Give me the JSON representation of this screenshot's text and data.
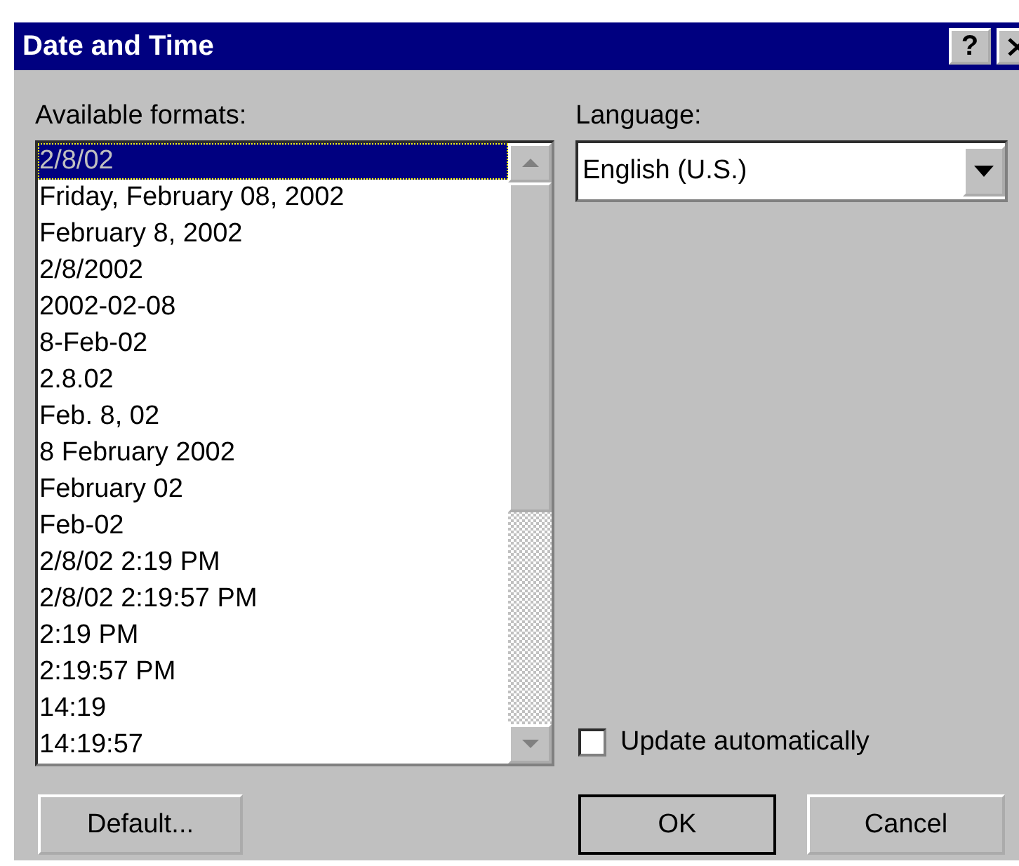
{
  "window": {
    "title": "Date and Time",
    "help_button": "?"
  },
  "formats": {
    "label": "Available formats:",
    "items": [
      {
        "text": "2/8/02",
        "selected": true
      },
      {
        "text": "Friday, February 08, 2002",
        "selected": false
      },
      {
        "text": "February 8, 2002",
        "selected": false
      },
      {
        "text": "2/8/2002",
        "selected": false
      },
      {
        "text": "2002-02-08",
        "selected": false
      },
      {
        "text": "8-Feb-02",
        "selected": false
      },
      {
        "text": "2.8.02",
        "selected": false
      },
      {
        "text": "Feb. 8, 02",
        "selected": false
      },
      {
        "text": "8 February 2002",
        "selected": false
      },
      {
        "text": "February 02",
        "selected": false
      },
      {
        "text": "Feb-02",
        "selected": false
      },
      {
        "text": "2/8/02 2:19 PM",
        "selected": false
      },
      {
        "text": "2/8/02 2:19:57 PM",
        "selected": false
      },
      {
        "text": "2:19 PM",
        "selected": false
      },
      {
        "text": "2:19:57 PM",
        "selected": false
      },
      {
        "text": "14:19",
        "selected": false
      },
      {
        "text": "14:19:57",
        "selected": false
      }
    ]
  },
  "language": {
    "label": "Language:",
    "value": "English (U.S.)"
  },
  "update_automatically": {
    "label": "Update automatically",
    "checked": false
  },
  "buttons": [
    {
      "label": "Default...",
      "default": false
    },
    {
      "label": "OK",
      "default": true
    },
    {
      "label": "Cancel",
      "default": false
    }
  ]
}
